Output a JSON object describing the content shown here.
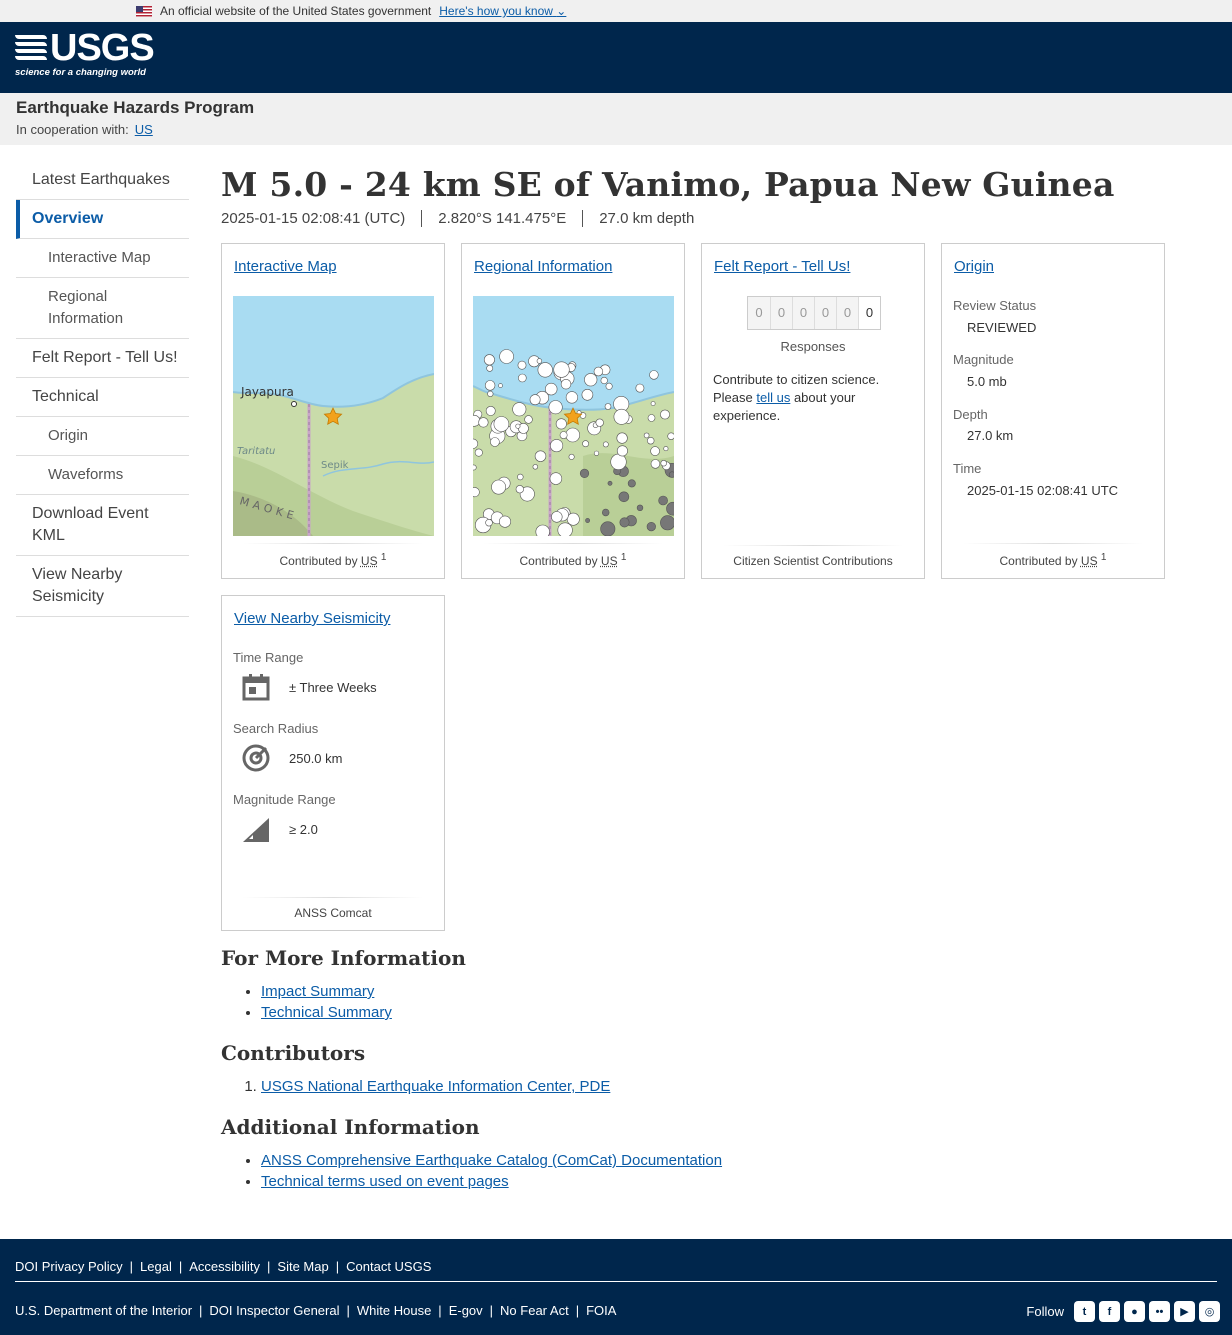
{
  "gov_banner": {
    "text": "An official website of the United States government",
    "link": "Here's how you know"
  },
  "header": {
    "logo_text": "USGS",
    "logo_tagline": "science for a changing world"
  },
  "program": {
    "name": "Earthquake Hazards Program",
    "coop_label": "In cooperation with:",
    "coop_link": "US"
  },
  "sidebar": {
    "items": [
      {
        "label": "Latest Earthquakes"
      },
      {
        "label": "Overview"
      },
      {
        "label": "Interactive Map"
      },
      {
        "label": "Regional Information"
      },
      {
        "label": "Felt Report - Tell Us!"
      },
      {
        "label": "Technical"
      },
      {
        "label": "Origin"
      },
      {
        "label": "Waveforms"
      },
      {
        "label": "Download Event KML"
      },
      {
        "label": "View Nearby Seismicity"
      }
    ]
  },
  "event": {
    "title": "M 5.0 - 24 km SE of Vanimo, Papua New Guinea",
    "time": "2025-01-15 02:08:41 (UTC)",
    "location": "2.820°S 141.475°E",
    "depth": "27.0 km depth"
  },
  "cards": {
    "interactive_map": {
      "title": "Interactive Map",
      "contributed": "Contributed by",
      "contributor": "US",
      "sup": "1",
      "labels": {
        "city": "Jayapura",
        "region1": "Taritatu",
        "region2": "Sepik",
        "region3": "MAOKE"
      }
    },
    "regional": {
      "title": "Regional Information",
      "contributed": "Contributed by",
      "contributor": "US",
      "sup": "1"
    },
    "felt": {
      "title": "Felt Report - Tell Us!",
      "digits": [
        "0",
        "0",
        "0",
        "0",
        "0",
        "0"
      ],
      "responses": "Responses",
      "text_before": "Contribute to citizen science. Please ",
      "text_link": "tell us",
      "text_after": " about your experience.",
      "footer": "Citizen Scientist Contributions"
    },
    "origin": {
      "title": "Origin",
      "review_status_label": "Review Status",
      "review_status": "REVIEWED",
      "magnitude_label": "Magnitude",
      "magnitude": "5.0 mb",
      "depth_label": "Depth",
      "depth": "27.0 km",
      "time_label": "Time",
      "time": "2025-01-15 02:08:41 UTC",
      "contributed": "Contributed by",
      "contributor": "US",
      "sup": "1"
    },
    "seismicity": {
      "title": "View Nearby Seismicity",
      "time_range_label": "Time Range",
      "time_range": "± Three Weeks",
      "search_radius_label": "Search Radius",
      "search_radius": "250.0 km",
      "magnitude_range_label": "Magnitude Range",
      "magnitude_range": "≥ 2.0",
      "footer": "ANSS Comcat"
    }
  },
  "more_info": {
    "heading": "For More Information",
    "links": [
      "Impact Summary",
      "Technical Summary"
    ]
  },
  "contributors": {
    "heading": "Contributors",
    "links": [
      "USGS National Earthquake Information Center, PDE"
    ]
  },
  "additional": {
    "heading": "Additional Information",
    "links": [
      "ANSS Comprehensive Earthquake Catalog (ComCat) Documentation",
      "Technical terms used on event pages"
    ]
  },
  "footer": {
    "row1": [
      "DOI Privacy Policy",
      "Legal",
      "Accessibility",
      "Site Map",
      "Contact USGS"
    ],
    "row2": [
      "U.S. Department of the Interior",
      "DOI Inspector General",
      "White House",
      "E-gov",
      "No Fear Act",
      "FOIA"
    ],
    "follow": "Follow",
    "social_icons": [
      "twitter-icon",
      "facebook-icon",
      "github-icon",
      "flickr-icon",
      "youtube-icon",
      "instagram-icon"
    ]
  },
  "colors": {
    "header_bg": "#00264c",
    "link": "#0b5ca7",
    "epicenter_star": "#f2a21c"
  }
}
